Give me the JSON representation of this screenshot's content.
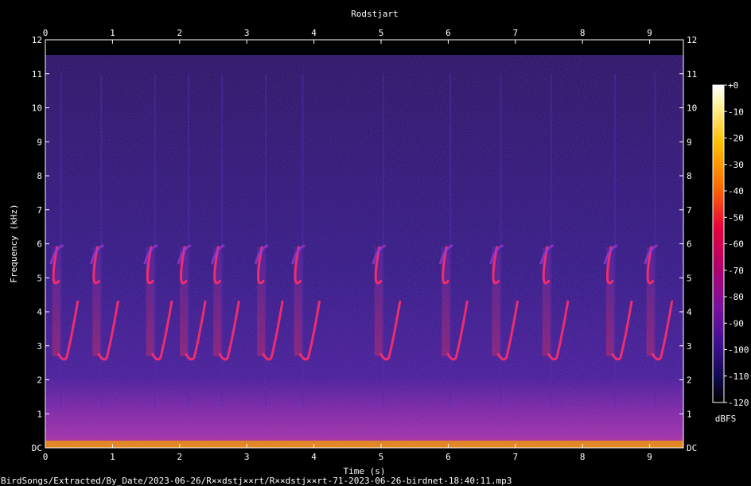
{
  "chart_data": {
    "type": "heatmap",
    "title": "Rodstjart",
    "xlabel": "Time (s)",
    "ylabel": "Frequency (kHz)",
    "x_ticks": [
      "0",
      "1",
      "2",
      "3",
      "4",
      "5",
      "6",
      "7",
      "8",
      "9"
    ],
    "y_ticks": [
      "DC",
      "1",
      "2",
      "3",
      "4",
      "5",
      "6",
      "7",
      "8",
      "9",
      "10",
      "11",
      "12"
    ],
    "xlim": [
      0,
      9.5
    ],
    "ylim": [
      0,
      12
    ],
    "colorbar": {
      "label": "dBFS",
      "ticks": [
        "+0",
        "-10",
        "-20",
        "-30",
        "-40",
        "-50",
        "-60",
        "-70",
        "-80",
        "-90",
        "-100",
        "-110",
        "-120"
      ],
      "range": [
        -120,
        0
      ]
    },
    "song_phrases": [
      {
        "t": 0.15,
        "freq_khz": [
          2.7,
          5.9
        ]
      },
      {
        "t": 0.75,
        "freq_khz": [
          2.7,
          5.9
        ]
      },
      {
        "t": 1.55,
        "freq_khz": [
          2.7,
          5.9
        ]
      },
      {
        "t": 2.05,
        "freq_khz": [
          2.7,
          5.9
        ]
      },
      {
        "t": 2.55,
        "freq_khz": [
          2.7,
          5.9
        ]
      },
      {
        "t": 3.2,
        "freq_khz": [
          2.7,
          5.9
        ]
      },
      {
        "t": 3.75,
        "freq_khz": [
          2.7,
          5.9
        ]
      },
      {
        "t": 4.95,
        "freq_khz": [
          2.7,
          5.9
        ]
      },
      {
        "t": 5.95,
        "freq_khz": [
          2.7,
          5.9
        ]
      },
      {
        "t": 6.7,
        "freq_khz": [
          2.7,
          5.9
        ]
      },
      {
        "t": 7.45,
        "freq_khz": [
          2.7,
          5.9
        ]
      },
      {
        "t": 8.4,
        "freq_khz": [
          2.7,
          5.9
        ]
      },
      {
        "t": 9.0,
        "freq_khz": [
          2.7,
          5.9
        ]
      }
    ],
    "filename": "BirdSongs/Extracted/By_Date/2023-06-26/R××dstj××rt/R××dstj××rt-71-2023-06-26-birdnet-18:40:11.mp3"
  }
}
